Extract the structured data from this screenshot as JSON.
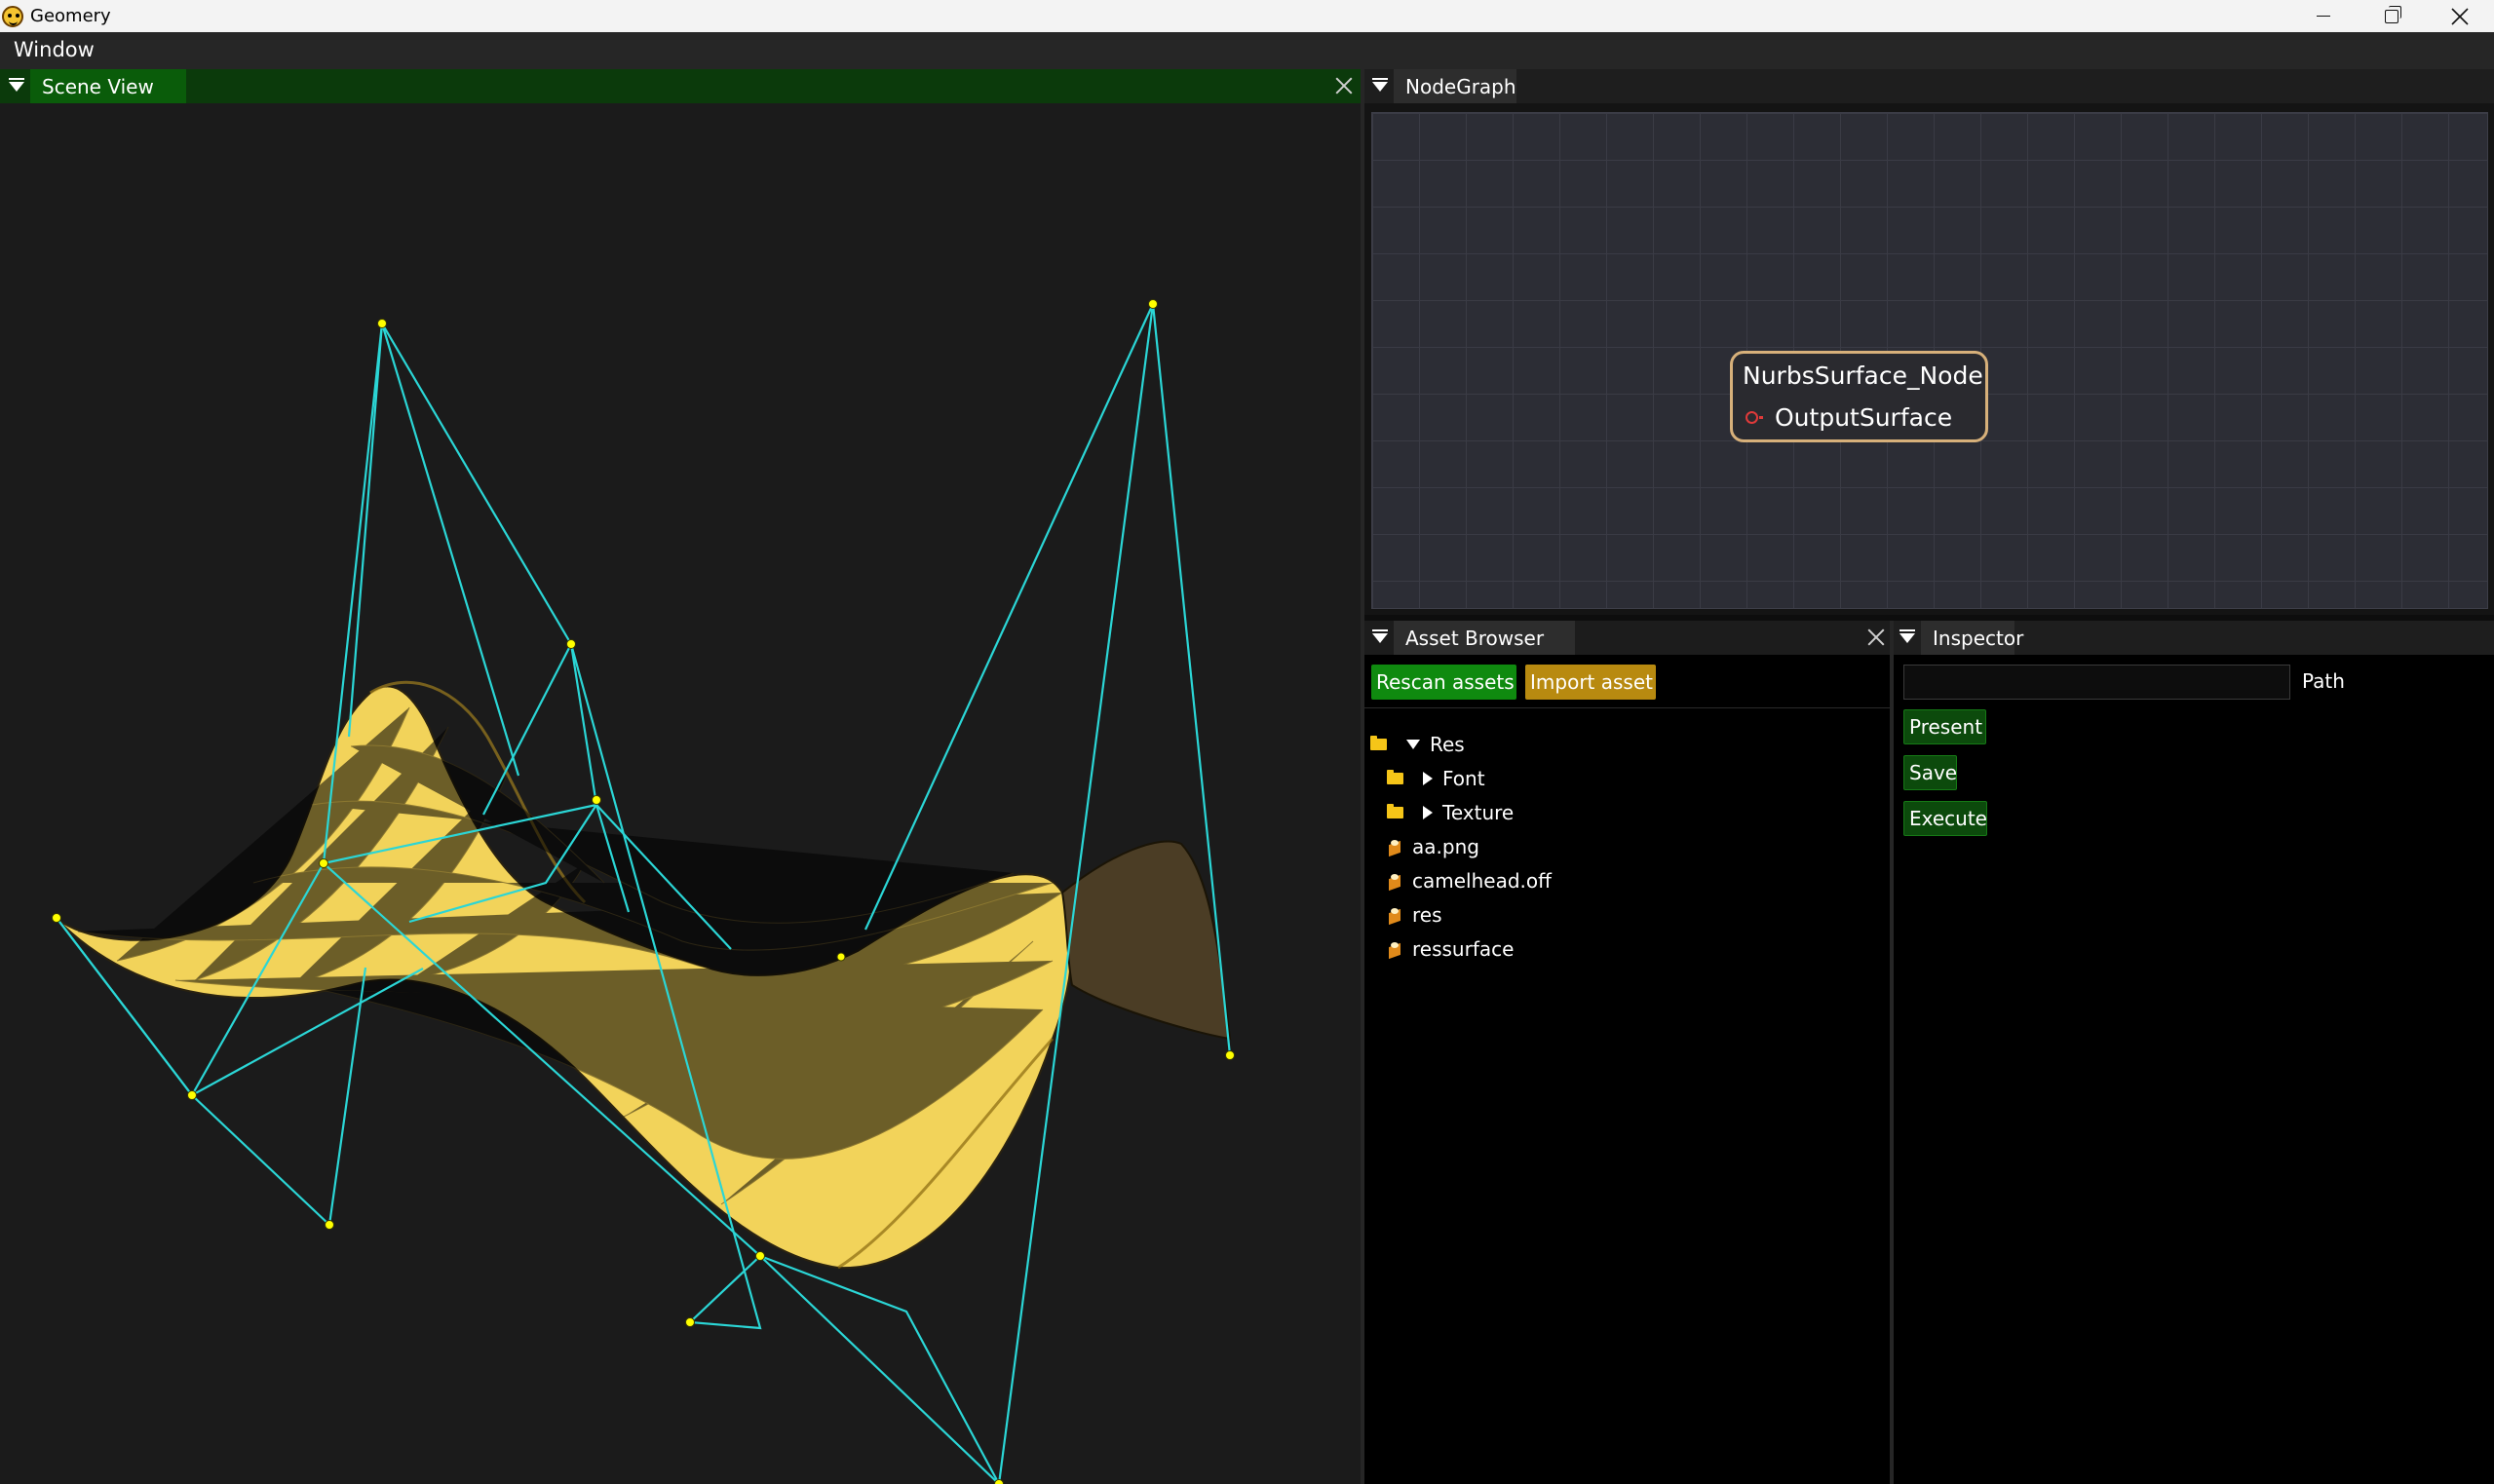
{
  "window": {
    "title": "Geomery",
    "icon": "smiley-icon",
    "controls": [
      "minimize",
      "maximize",
      "close"
    ]
  },
  "menubar": {
    "items": [
      "Window"
    ]
  },
  "scene_view": {
    "tab_label": "Scene View"
  },
  "node_graph": {
    "tab_label": "NodeGraph",
    "node": {
      "title": "NurbsSurface_Node",
      "output_label": "OutputSurface"
    }
  },
  "asset_browser": {
    "tab_label": "Asset Browser",
    "rescan_label": "Rescan assets",
    "import_label": "Import asset",
    "tree": {
      "root": "Res",
      "folders": [
        "Font",
        "Texture"
      ],
      "files": [
        "aa.png",
        "camelhead.off",
        "res",
        "ressurface"
      ]
    }
  },
  "inspector": {
    "tab_label": "Inspector",
    "path_value": "",
    "path_label": "Path",
    "present_label": "Present",
    "save_label": "Save",
    "execute_label": "Execute"
  },
  "colors": {
    "surface": "#f2d35a",
    "control_polygon": "#2bd6d6",
    "control_point": "#ffff00",
    "active_tab": "#0a5c0a",
    "node_border": "#d7b07a",
    "port": "#e03a3a"
  }
}
